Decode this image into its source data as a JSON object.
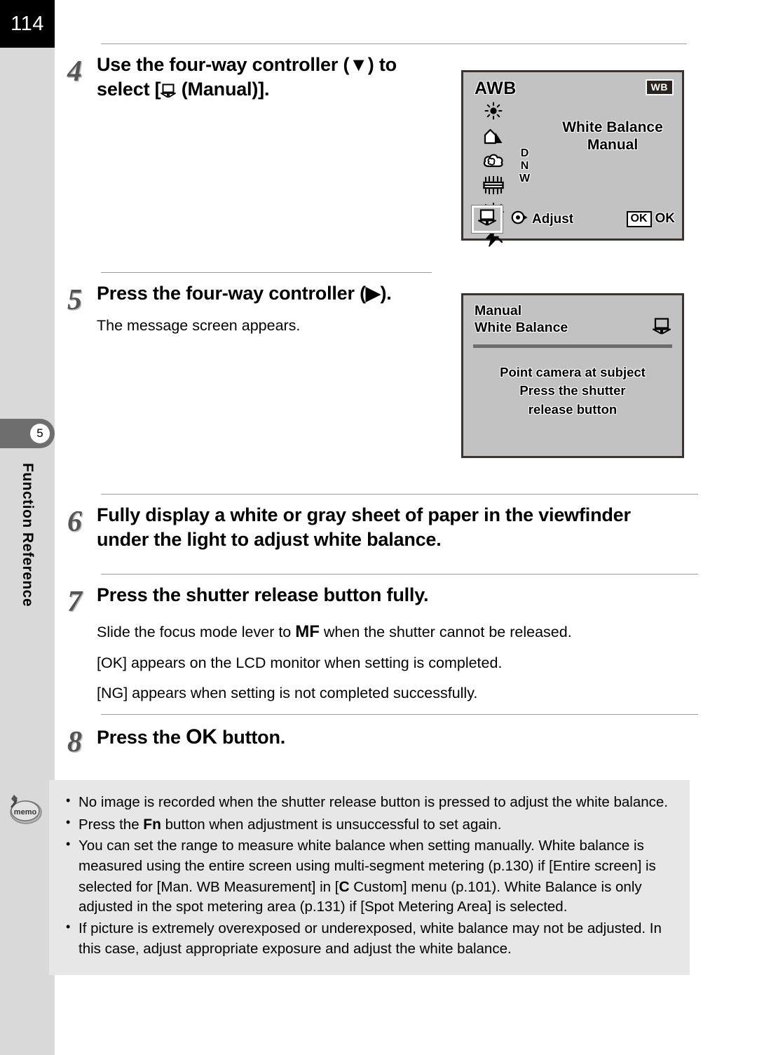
{
  "page": {
    "number": "114",
    "chapter_number": "5",
    "chapter_label": "Function Reference"
  },
  "steps": [
    {
      "number": "4",
      "heading_part1": "Use the four-way controller (",
      "heading_arrow": "▼",
      "heading_part2": ") to select [",
      "heading_icon": "manual-wb-icon",
      "heading_part3": " (Manual)]."
    },
    {
      "number": "5",
      "heading_part1": "Press the four-way controller (",
      "heading_arrow": "▶",
      "heading_part2": ").",
      "sub": "The message screen appears."
    },
    {
      "number": "6",
      "heading": "Fully display a white or gray sheet of paper in the viewfinder under the light to adjust white balance."
    },
    {
      "number": "7",
      "heading": "Press the shutter release button fully.",
      "sub_lines": [
        {
          "pre": "Slide the focus mode lever to ",
          "bold": "MF",
          "post": " when the shutter cannot be released."
        },
        {
          "pre": "[OK] appears on the LCD monitor when setting is completed.",
          "bold": "",
          "post": ""
        },
        {
          "pre": "[NG] appears when setting is not completed successfully.",
          "bold": "",
          "post": ""
        }
      ]
    },
    {
      "number": "8",
      "heading_pre": "Press the ",
      "heading_bold": "OK",
      "heading_post": " button."
    }
  ],
  "lcd_screen_1": {
    "awb_label": "AWB",
    "wb_badge": "WB",
    "title_line1": "White Balance",
    "title_line2": "Manual",
    "dnw": [
      "D",
      "N",
      "W"
    ],
    "icons": [
      "daylight-sun-icon",
      "shade-icon",
      "cloudy-icon",
      "fluorescent-icon",
      "tungsten-icon",
      "flash-icon",
      "manual-wb-icon"
    ],
    "adjust_label": "Adjust",
    "ok_badge": "OK",
    "ok_label": "OK",
    "selected_icon": "manual-wb-icon"
  },
  "lcd_screen_2": {
    "head_line1": "Manual",
    "head_line2": "White Balance",
    "corner_icon": "manual-wb-icon",
    "message_lines": [
      "Point camera at subject",
      "Press the shutter",
      "release button"
    ]
  },
  "memo": {
    "icon_label": "memo",
    "items": [
      {
        "pre": "No image is recorded when the shutter release button is pressed to adjust the white balance.",
        "bold": "",
        "post": ""
      },
      {
        "pre": "Press the ",
        "bold": "Fn",
        "post": " button when adjustment is unsuccessful to set again."
      },
      {
        "pre": "You can set the range to measure white balance when setting manually. White balance is measured using the entire screen using multi-segment metering (p.130) if [Entire screen] is selected for [Man. WB Measurement] in [",
        "bold": "C",
        "post": " Custom] menu (p.101). White Balance is only adjusted in the spot metering area (p.131) if [Spot Metering Area] is selected."
      },
      {
        "pre": "If picture is extremely overexposed or underexposed, white balance may not be adjusted. In this case, adjust appropriate exposure and adjust the white balance.",
        "bold": "",
        "post": ""
      }
    ]
  },
  "colors": {
    "page_block": "#000000",
    "sidebar": "#d9d9d9",
    "chapter_tab": "#6e6e6e",
    "lcd_bg": "#c2c2c2",
    "lcd_border": "#3a3330",
    "memo_bg": "#e7e7e7",
    "rule": "#9a9a9a",
    "step_number": "#555555"
  }
}
